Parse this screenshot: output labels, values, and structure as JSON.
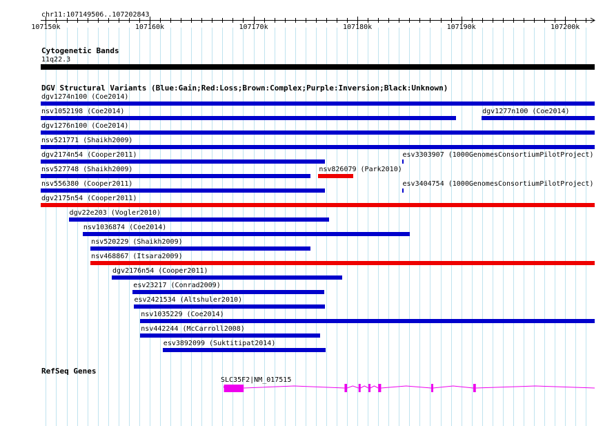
{
  "browser": {
    "region": "chr11:107149506..107202843",
    "region_start": 107149506,
    "region_end": 107202843,
    "ruler_ticks": [
      {
        "label": "107150k",
        "pos": 107150000
      },
      {
        "label": "107160k",
        "pos": 107160000
      },
      {
        "label": "107170k",
        "pos": 107170000
      },
      {
        "label": "107180k",
        "pos": 107180000
      },
      {
        "label": "107190k",
        "pos": 107190000
      },
      {
        "label": "107200k",
        "pos": 107200000
      }
    ]
  },
  "cytoband_track": {
    "title": "Cytogenetic Bands",
    "band_label": "11q22.3",
    "color": "#000000"
  },
  "dgv_track": {
    "title": "DGV Structural Variants (Blue:Gain;Red:Loss;Brown:Complex;Purple:Inversion;Black:Unknown)",
    "colors": {
      "gain": "#0000cc",
      "loss": "#ee0000"
    },
    "features": [
      {
        "label": "dgv1274n100 (Coe2014)",
        "start": 107149506,
        "end": 107202843,
        "type": "gain",
        "row": 0
      },
      {
        "label": "nsv1052198 (Coe2014)",
        "start": 107149506,
        "end": 107189510,
        "type": "gain",
        "row": 1
      },
      {
        "label": "dgv1277n100 (Coe2014)",
        "start": 107191960,
        "end": 107202843,
        "type": "gain",
        "row": 1
      },
      {
        "label": "dgv1276n100 (Coe2014)",
        "start": 107149506,
        "end": 107202843,
        "type": "gain",
        "row": 2
      },
      {
        "label": "nsv521771 (Shaikh2009)",
        "start": 107149506,
        "end": 107202843,
        "type": "gain",
        "row": 3
      },
      {
        "label": "dgv2174n54 (Cooper2011)",
        "start": 107149506,
        "end": 107176880,
        "type": "gain",
        "row": 4
      },
      {
        "label": "esv3303907 (1000GenomesConsortiumPilotProject)",
        "start": 107184280,
        "end": 107184380,
        "type": "gain",
        "row": 4
      },
      {
        "label": "nsv527748 (Shaikh2009)",
        "start": 107149506,
        "end": 107175480,
        "type": "gain",
        "row": 5
      },
      {
        "label": "nsv826079 (Park2010)",
        "start": 107176230,
        "end": 107179580,
        "type": "loss",
        "row": 5
      },
      {
        "label": "nsv556380 (Cooper2011)",
        "start": 107149506,
        "end": 107176880,
        "type": "gain",
        "row": 6
      },
      {
        "label": "esv3404754 (1000GenomesConsortiumPilotProject)",
        "start": 107184280,
        "end": 107184380,
        "type": "gain",
        "row": 6
      },
      {
        "label": "dgv2175n54 (Cooper2011)",
        "start": 107149506,
        "end": 107202843,
        "type": "loss",
        "row": 7
      },
      {
        "label": "dgv22e203 (Vogler2010)",
        "start": 107152200,
        "end": 107177280,
        "type": "gain",
        "row": 8
      },
      {
        "label": "nsv1036874 (Coe2014)",
        "start": 107153550,
        "end": 107185040,
        "type": "gain",
        "row": 9
      },
      {
        "label": "nsv520229 (Shaikh2009)",
        "start": 107154300,
        "end": 107175480,
        "type": "gain",
        "row": 10
      },
      {
        "label": "nsv468867 (Itsara2009)",
        "start": 107154300,
        "end": 107202843,
        "type": "loss",
        "row": 11
      },
      {
        "label": "dgv2176n54 (Cooper2011)",
        "start": 107156350,
        "end": 107178560,
        "type": "gain",
        "row": 12
      },
      {
        "label": "esv23217 (Conrad2009)",
        "start": 107158360,
        "end": 107176820,
        "type": "gain",
        "row": 13
      },
      {
        "label": "esv2421534 (Altshuler2010)",
        "start": 107158440,
        "end": 107176880,
        "type": "gain",
        "row": 14
      },
      {
        "label": "nsv1035229 (Coe2014)",
        "start": 107159090,
        "end": 107202843,
        "type": "gain",
        "row": 15
      },
      {
        "label": "nsv442244 (McCarroll2008)",
        "start": 107159090,
        "end": 107176420,
        "type": "gain",
        "row": 16
      },
      {
        "label": "esv3892099 (Suktitipat2014)",
        "start": 107161250,
        "end": 107176950,
        "type": "gain",
        "row": 17
      }
    ]
  },
  "refseq_track": {
    "title": "RefSeq Genes",
    "color": "#ee00ee",
    "gene": {
      "label": "SLC35F2|NM_017515",
      "start": 107167150,
      "end": 107202843,
      "exons": [
        {
          "start": 107167150,
          "end": 107169050,
          "thick": true
        },
        {
          "start": 107178760,
          "end": 107179000,
          "thick": false
        },
        {
          "start": 107180110,
          "end": 107180290,
          "thick": false
        },
        {
          "start": 107181060,
          "end": 107181240,
          "thick": false
        },
        {
          "start": 107182000,
          "end": 107182280,
          "thick": false
        },
        {
          "start": 107187100,
          "end": 107187280,
          "thick": false
        },
        {
          "start": 107191150,
          "end": 107191400,
          "thick": false
        }
      ]
    }
  }
}
